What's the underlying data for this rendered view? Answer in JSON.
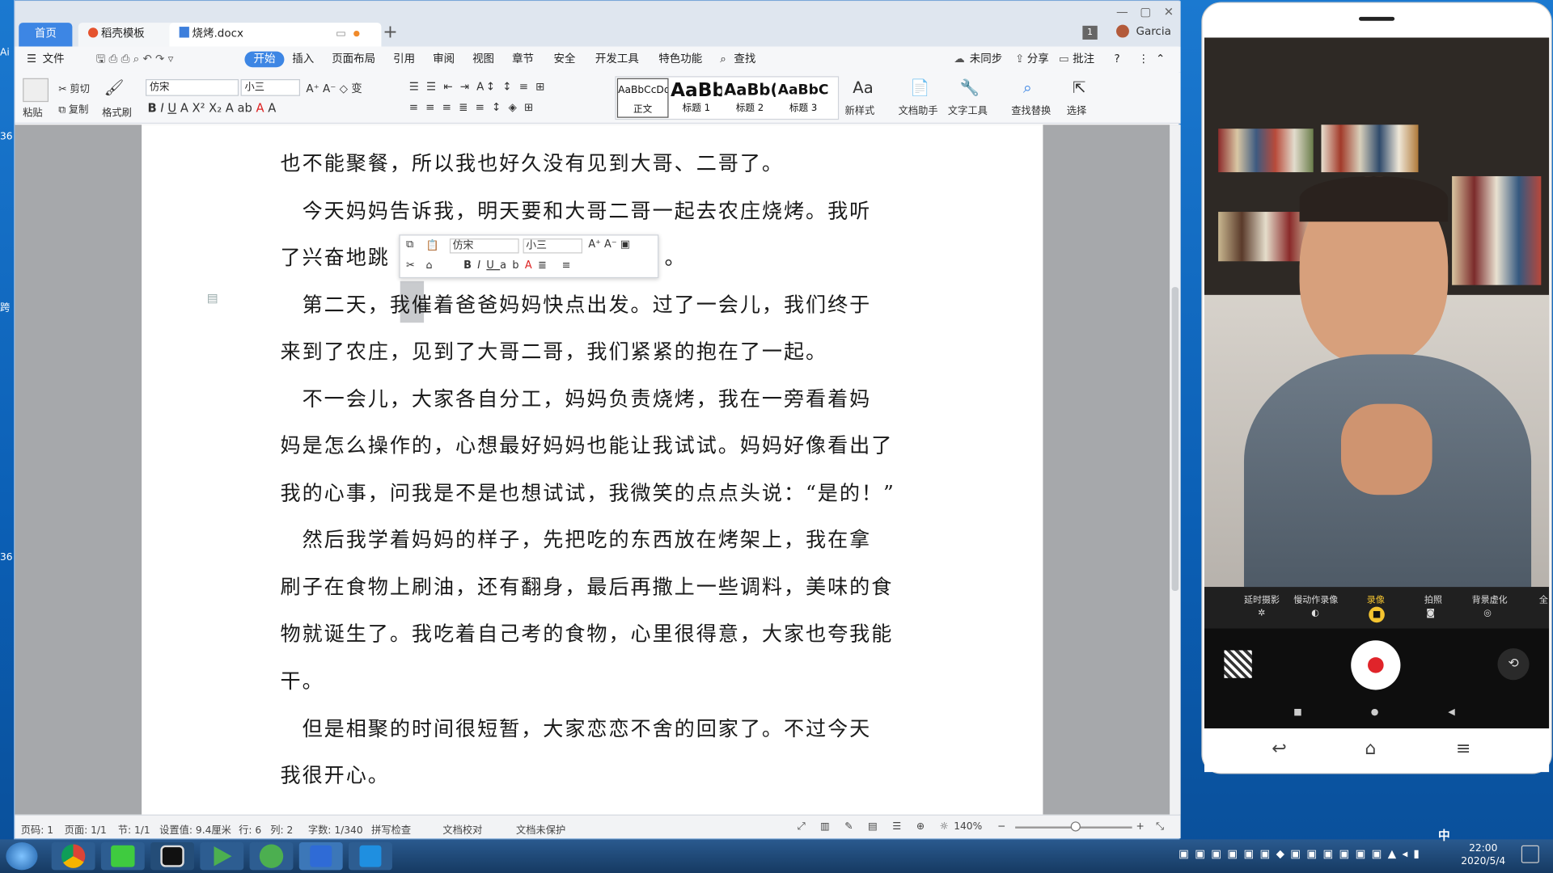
{
  "desktop": {
    "left_labels": [
      "Ai",
      "36",
      "跨",
      "36"
    ]
  },
  "window": {
    "tabs": {
      "home": "首页",
      "template": "稻壳模板",
      "document": "烧烤.docx",
      "add": "+"
    },
    "page_indicator": "1",
    "user": "Garcia",
    "menu": [
      "文件",
      "开始",
      "插入",
      "页面布局",
      "引用",
      "审阅",
      "视图",
      "章节",
      "安全",
      "开发工具",
      "特色功能",
      "查找"
    ],
    "menu_right": {
      "sync": "未同步",
      "share": "分享",
      "comment": "批注",
      "help": "?"
    },
    "ribbon": {
      "paste": "粘贴",
      "cut": "剪切",
      "copy": "复制",
      "format_painter": "格式刷",
      "font": "仿宋",
      "size": "小三",
      "styles": [
        {
          "preview": "AaBbCcDd",
          "name": "正文"
        },
        {
          "preview": "AaBb",
          "name": "标题 1"
        },
        {
          "preview": "AaBb(",
          "name": "标题 2"
        },
        {
          "preview": "AaBbC",
          "name": "标题 3"
        }
      ],
      "new_style": "新样式",
      "doc_helper": "文档助手",
      "text_tools": "文字工具",
      "find_replace": "查找替换",
      "select": "选择"
    },
    "float_toolbar": {
      "font": "仿宋",
      "size": "小三"
    },
    "document": {
      "lines": [
        "也不能聚餐，所以我也好久没有见到大哥、二哥了。",
        "　今天妈妈告诉我，明天要和大哥二哥一起去农庄烧烤。我听",
        "了兴奋地跳",
        "　第二天，我催着爸爸妈妈快点出发。过了一会儿，我们终于",
        "来到了农庄，见到了大哥二哥，我们紧紧的抱在了一起。",
        "　不一会儿，大家各自分工，妈妈负责烧烤，我在一旁看着妈",
        "妈是怎么操作的，心想最好妈妈也能让我试试。妈妈好像看出了",
        "我的心事，问我是不是也想试试，我微笑的点点头说：“是的！”",
        "　然后我学着妈妈的样子，先把吃的东西放在烤架上，我在拿",
        "刷子在食物上刷油，还有翻身，最后再撒上一些调料，美味的食",
        "物就诞生了。我吃着自己考的食物，心里很得意，大家也夸我能",
        "干。",
        "　但是相聚的时间很短暂，大家恋恋不舍的回家了。不过今天",
        "我很开心。"
      ],
      "line2_tail": "。"
    },
    "status": {
      "page_code": "页码: 1",
      "pages": "页面: 1/1",
      "section": "节: 1/1",
      "setting": "设置值: 9.4厘米",
      "row": "行: 6",
      "col": "列: 2",
      "words": "字数: 1/340",
      "spell": "拼写检查",
      "proof": "文档校对",
      "protect": "文档未保护",
      "zoom": "140%"
    }
  },
  "phone": {
    "modes": [
      "延时摄影",
      "慢动作录像",
      "录像",
      "拍照",
      "背景虚化",
      "全"
    ],
    "active_mode": "录像"
  },
  "taskbar": {
    "time": "22:00",
    "date": "2020/5/4",
    "ime": "中"
  },
  "colors": {
    "accent": "#3d86e4",
    "record": "#e0242a"
  }
}
